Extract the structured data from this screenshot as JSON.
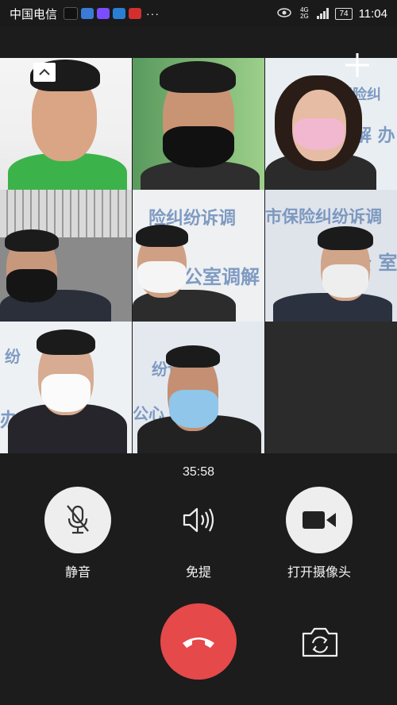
{
  "status_bar": {
    "carrier": "中国电信",
    "battery": "74",
    "network": "4G 2G",
    "time": "11:04",
    "more": "···"
  },
  "call": {
    "timer": "35:58",
    "participants": [
      {
        "wall_text": ""
      },
      {
        "wall_text": ""
      },
      {
        "wall_text": "保险纠"
      },
      {
        "wall_text": ""
      },
      {
        "wall_text": "险纠纷诉调"
      },
      {
        "wall_text": "市保险纠纷诉调"
      },
      {
        "wall_text": "纷"
      },
      {
        "wall_text": "纷诉"
      },
      {
        "wall_text": ""
      }
    ],
    "wall_text_2": "解 办",
    "wall_text_5": "办公室调解",
    "wall_text_6": "公 室",
    "wall_text_7": "办公",
    "wall_text_8": "公心 州市"
  },
  "controls": {
    "mute_label": "静音",
    "speaker_label": "免提",
    "camera_label": "打开摄像头"
  },
  "colors": {
    "hangup": "#e5494a",
    "control_bg": "#eeeeee",
    "background": "#1c1c1c"
  }
}
